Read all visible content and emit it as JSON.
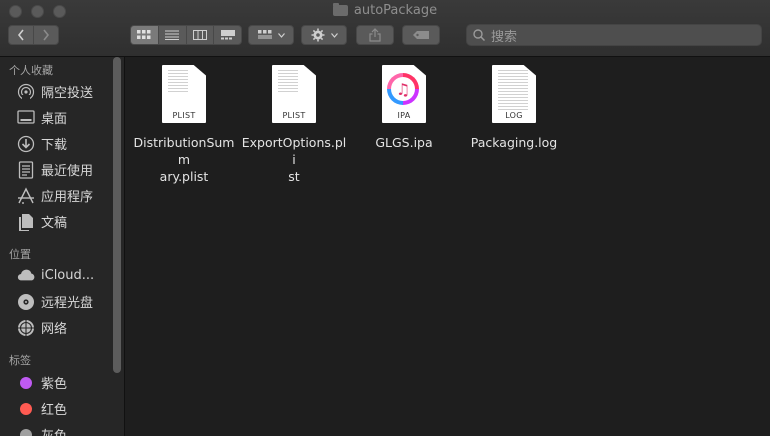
{
  "window": {
    "title": "autoPackage"
  },
  "toolbar": {
    "back_icon": "chevron-left-icon",
    "forward_icon": "chevron-right-icon",
    "view_modes": [
      "icon-view",
      "list-view",
      "column-view",
      "gallery-view"
    ],
    "active_view": "icon-view",
    "group_icon": "group-icon",
    "action_icon": "gear-icon",
    "share_icon": "share-icon",
    "tag_icon": "tag-icon",
    "search_placeholder": "搜索"
  },
  "sidebar": {
    "sections": [
      {
        "heading": "个人收藏",
        "items": [
          {
            "label": "隔空投送",
            "icon": "airdrop-icon"
          },
          {
            "label": "桌面",
            "icon": "desktop-icon"
          },
          {
            "label": "下载",
            "icon": "downloads-icon"
          },
          {
            "label": "最近使用",
            "icon": "recents-icon"
          },
          {
            "label": "应用程序",
            "icon": "applications-icon"
          },
          {
            "label": "文稿",
            "icon": "documents-icon"
          }
        ]
      },
      {
        "heading": "位置",
        "items": [
          {
            "label": "iCloud...",
            "icon": "icloud-icon"
          },
          {
            "label": "远程光盘",
            "icon": "remote-disc-icon"
          },
          {
            "label": "网络",
            "icon": "network-icon"
          }
        ]
      },
      {
        "heading": "标签",
        "items": [
          {
            "label": "紫色",
            "color": "#bf5af2"
          },
          {
            "label": "红色",
            "color": "#ff5b52"
          },
          {
            "label": "灰色",
            "color": "#a0a0a0"
          }
        ]
      }
    ]
  },
  "files": [
    {
      "name": "DistributionSummary.plist",
      "name_line1": "DistributionSumm",
      "name_line2": "ary.plist",
      "ext": "PLIST",
      "icon": "plist-file-icon"
    },
    {
      "name": "ExportOptions.plist",
      "name_line1": "ExportOptions.pli",
      "name_line2": "st",
      "ext": "PLIST",
      "icon": "plist-file-icon"
    },
    {
      "name": "GLGS.ipa",
      "name_line1": "GLGS.ipa",
      "name_line2": "",
      "ext": "IPA",
      "icon": "ipa-file-icon"
    },
    {
      "name": "Packaging.log",
      "name_line1": "Packaging.log",
      "name_line2": "",
      "ext": "LOG",
      "icon": "log-file-icon"
    }
  ]
}
